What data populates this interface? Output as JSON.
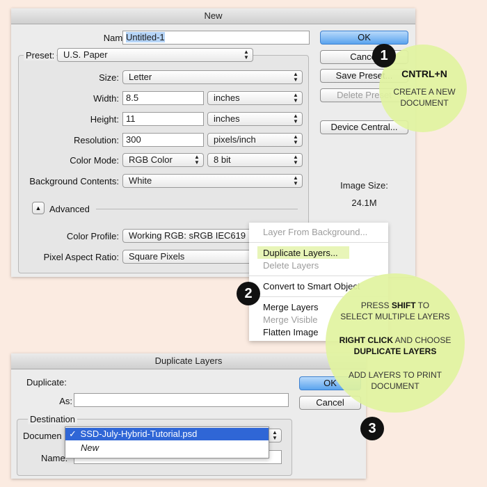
{
  "new_dialog": {
    "title": "New",
    "name_label": "Name:",
    "name_value": "Untitled-1",
    "preset_label": "Preset:",
    "preset_value": "U.S. Paper",
    "size_label": "Size:",
    "size_value": "Letter",
    "width_label": "Width:",
    "width_value": "8.5",
    "width_unit": "inches",
    "height_label": "Height:",
    "height_value": "11",
    "height_unit": "inches",
    "resolution_label": "Resolution:",
    "resolution_value": "300",
    "resolution_unit": "pixels/inch",
    "color_mode_label": "Color Mode:",
    "color_mode_value": "RGB Color",
    "bit_depth_value": "8 bit",
    "background_label": "Background Contents:",
    "background_value": "White",
    "advanced_label": "Advanced",
    "color_profile_label": "Color Profile:",
    "color_profile_value": "Working RGB:  sRGB IEC619",
    "pixel_aspect_label": "Pixel Aspect Ratio:",
    "pixel_aspect_value": "Square Pixels",
    "buttons": {
      "ok": "OK",
      "cancel": "Cancel",
      "save_preset": "Save Preset...",
      "delete_preset": "Delete Preset",
      "device_central": "Device Central..."
    },
    "image_size_label": "Image Size:",
    "image_size_value": "24.1M"
  },
  "context_menu": {
    "items": [
      {
        "label": "Layer From Background...",
        "enabled": false
      },
      {
        "label": "Duplicate Layers...",
        "enabled": true,
        "highlighted": true
      },
      {
        "label": "Delete Layers",
        "enabled": false
      },
      {
        "label": "Convert to Smart Object",
        "enabled": true
      },
      {
        "label": "Merge Layers",
        "enabled": true
      },
      {
        "label": "Merge Visible",
        "enabled": false
      },
      {
        "label": "Flatten Image",
        "enabled": true
      }
    ]
  },
  "duplicate_dialog": {
    "title": "Duplicate Layers",
    "duplicate_label": "Duplicate:",
    "as_label": "As:",
    "as_value": "",
    "destination_label": "Destination",
    "document_label": "Documen",
    "document_options": [
      {
        "label": "SSD-July-Hybrid-Tutorial.psd",
        "checked": true,
        "check": "✓"
      },
      {
        "label": "New",
        "checked": false
      }
    ],
    "name_label": "Name:",
    "name_value": "",
    "ok": "OK",
    "cancel": "Cancel"
  },
  "callouts": {
    "step1": {
      "number": "1",
      "heading": "CNTRL+N",
      "line1": "CREATE A NEW",
      "line2": "DOCUMENT"
    },
    "step2": {
      "number": "2"
    },
    "step3": {
      "number": "3",
      "l1_pre": "PRESS ",
      "l1_bold": "SHIFT",
      "l1_post": " TO",
      "l2": "SELECT MULTIPLE LAYERS",
      "l3_bold": "RIGHT CLICK",
      "l3_post": " AND CHOOSE",
      "l4_bold": "DUPLICATE LAYERS",
      "l5": "ADD LAYERS TO PRINT",
      "l6": "DOCUMENT"
    }
  },
  "colors": {
    "background": "#fbebe1",
    "bubble": "#e1f3a0",
    "primary_button": "#5aa3ee",
    "highlight": "#e8f5b8"
  }
}
